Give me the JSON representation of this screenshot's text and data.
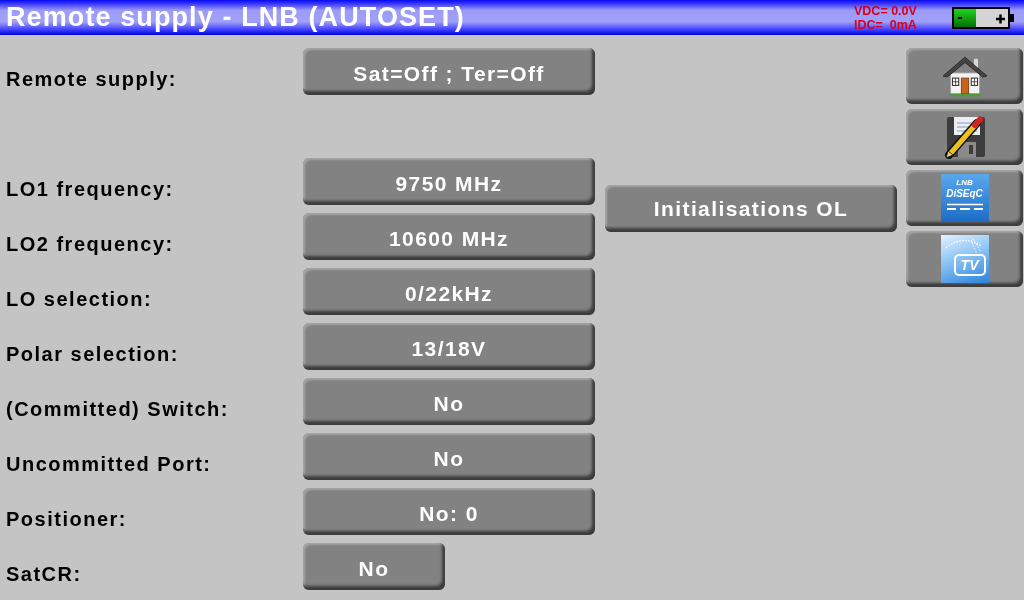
{
  "title_bar": {
    "title": "Remote supply - LNB (AUTOSET)",
    "readings": [
      "VDC= 0.0V",
      "IDC=  0mA"
    ]
  },
  "form": {
    "sections": [
      {
        "rows": [
          {
            "label": "Remote supply:",
            "value": "Sat=Off ; Ter=Off",
            "kind": "wide"
          }
        ]
      },
      {
        "rows": [
          {
            "label": "LO1 frequency:",
            "value": "9750 MHz",
            "kind": "wide"
          },
          {
            "label": "LO2 frequency:",
            "value": "10600 MHz",
            "kind": "wide"
          },
          {
            "label": "LO selection:",
            "value": "0/22kHz",
            "kind": "wide"
          },
          {
            "label": "Polar selection:",
            "value": "13/18V",
            "kind": "wide"
          },
          {
            "label": "(Committed) Switch:",
            "value": "No",
            "kind": "wide"
          },
          {
            "label": "Uncommitted Port:",
            "value": "No",
            "kind": "wide"
          },
          {
            "label": "Positioner:",
            "value": "No: 0",
            "kind": "wide"
          },
          {
            "label": "SatCR:",
            "value": "No",
            "kind": "narrow"
          }
        ]
      }
    ]
  },
  "init_button": {
    "label": "Initialisations OL"
  },
  "side_buttons": [
    {
      "kind": "home"
    },
    {
      "kind": "save"
    },
    {
      "kind": "diseqc",
      "logo_lines": [
        "LNB",
        "DiSEqC"
      ]
    },
    {
      "kind": "tv",
      "logo_text": "TV"
    }
  ]
}
